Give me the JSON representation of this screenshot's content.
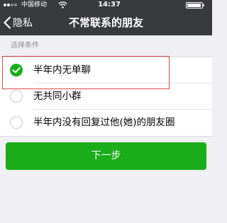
{
  "status_bar": {
    "carrier": "中国移动",
    "time": "14:37"
  },
  "nav": {
    "back_label": "隐私",
    "title": "不常联系的朋友"
  },
  "section_header": "选择条件",
  "options": [
    {
      "label": "半年内无单聊",
      "checked": true
    },
    {
      "label": "无共同小群",
      "checked": false
    },
    {
      "label": "半年内没有回复过他(她)的朋友圈",
      "checked": false
    }
  ],
  "next_button_label": "下一步",
  "colors": {
    "nav_background": "#393a3e",
    "accent_green": "#1aad19",
    "highlight_red": "#d9474d",
    "page_background": "#efeff4"
  },
  "icons": {
    "signal": "signal-dots-icon",
    "wifi": "wifi-icon",
    "battery": "battery-icon",
    "back": "chevron-left-icon",
    "checked": "checkmark-icon"
  }
}
